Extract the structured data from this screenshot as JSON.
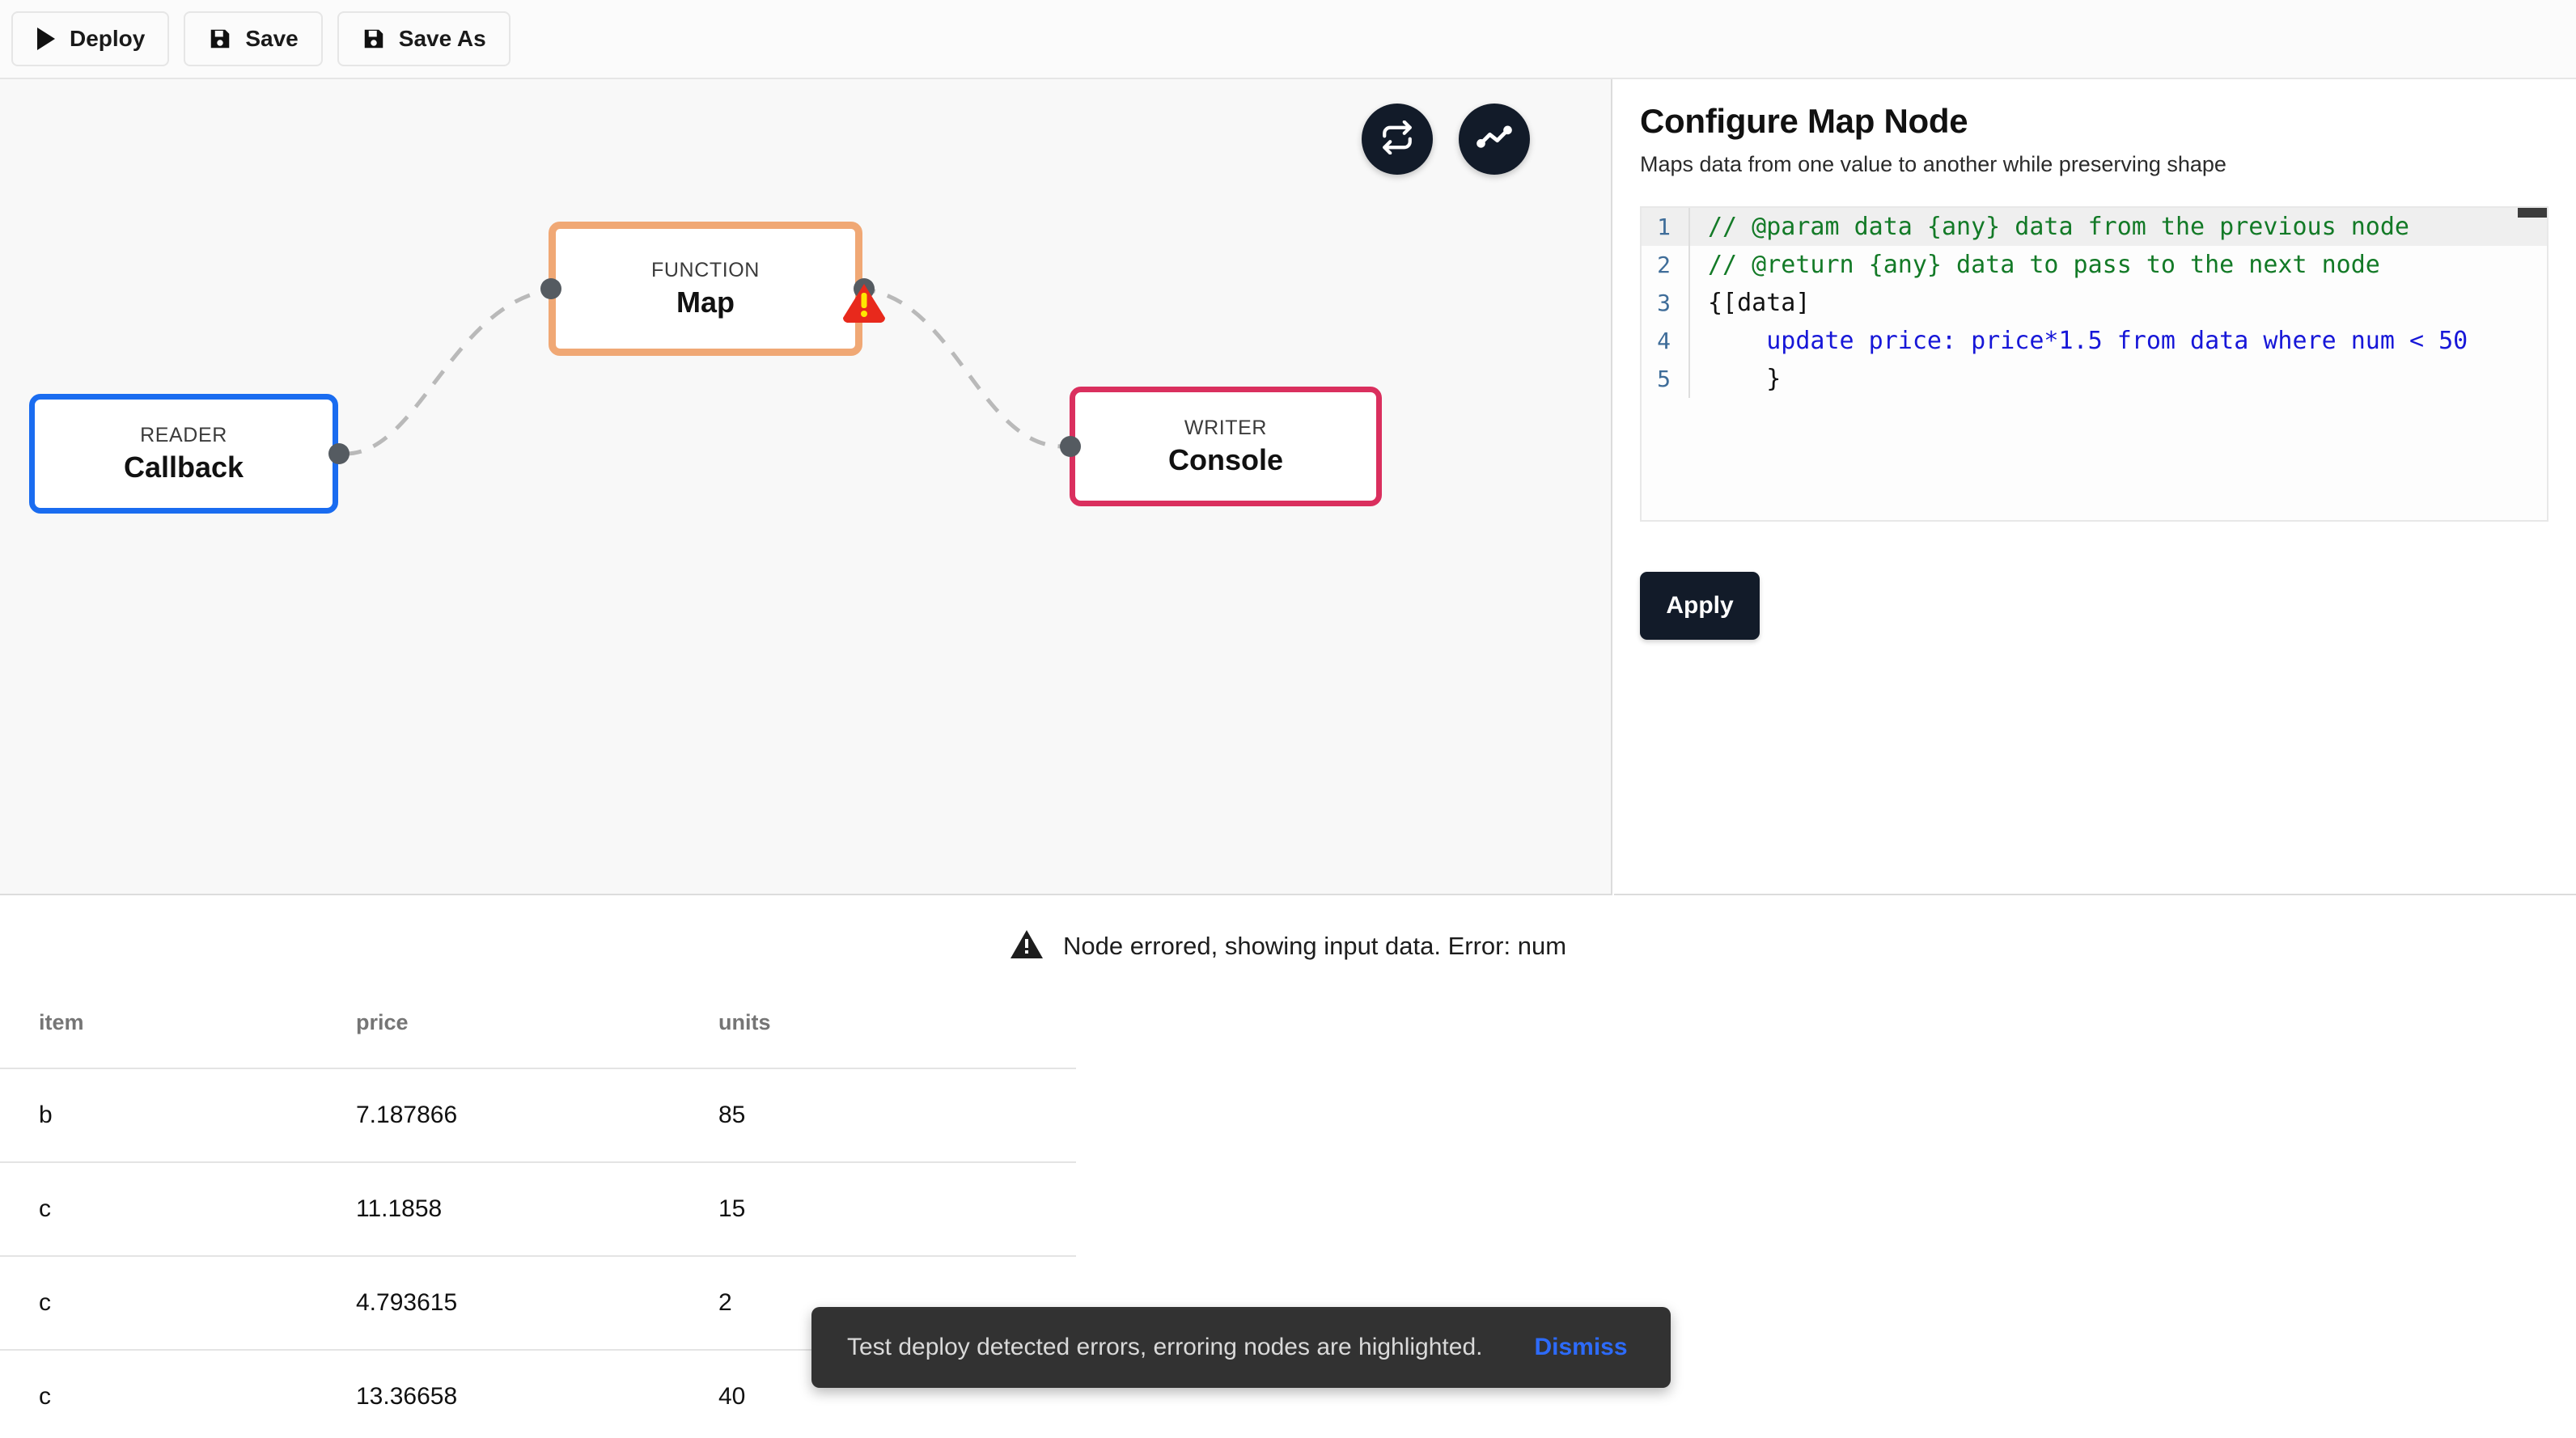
{
  "toolbar": {
    "buttons": [
      {
        "label": "Deploy",
        "icon": "play-icon"
      },
      {
        "label": "Save",
        "icon": "floppy-disk-icon"
      },
      {
        "label": "Save As",
        "icon": "floppy-disk-icon"
      }
    ]
  },
  "canvas": {
    "actions": [
      {
        "name": "refresh-icon",
        "title": "Refresh"
      },
      {
        "name": "activity-chart-icon",
        "title": "Test run"
      }
    ],
    "nodes": [
      {
        "kind": "READER",
        "name": "Callback",
        "color": "#1a6cf0"
      },
      {
        "kind": "FUNCTION",
        "name": "Map",
        "color": "#f0a875",
        "error": true
      },
      {
        "kind": "WRITER",
        "name": "Console",
        "color": "#da2f5e"
      }
    ],
    "warning_badge": {
      "name": "error-warning-icon",
      "fill": "#e8291c",
      "mark": "#ffe600"
    }
  },
  "panel": {
    "title": "Configure Map Node",
    "subtitle": "Maps data from one value to another while preserving shape",
    "apply_label": "Apply",
    "editor": {
      "lines": [
        {
          "no": "1",
          "text": "// @param data {any} data from the previous node"
        },
        {
          "no": "2",
          "text": "// @return {any} data to pass to the next node"
        },
        {
          "no": "3",
          "text": "{[data]"
        },
        {
          "no": "4",
          "text": "    update price: price*1.5 from data where num < 50"
        },
        {
          "no": "5",
          "text": "    }"
        }
      ]
    }
  },
  "results": {
    "error_message": "Node errored, showing input data. Error: num",
    "error_icon": "warning-triangle-icon",
    "table": {
      "columns": [
        "item",
        "price",
        "units"
      ],
      "rows": [
        [
          "b",
          "7.187866",
          "85"
        ],
        [
          "c",
          "11.1858",
          "15"
        ],
        [
          "c",
          "4.793615",
          "2"
        ],
        [
          "c",
          "13.36658",
          "40"
        ]
      ]
    }
  },
  "toast": {
    "message": "Test deploy detected errors, erroring nodes are highlighted.",
    "action_label": "Dismiss"
  }
}
